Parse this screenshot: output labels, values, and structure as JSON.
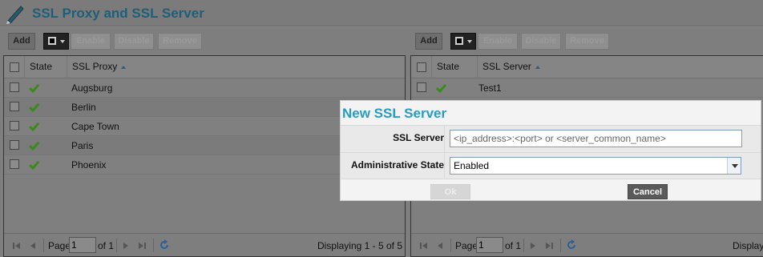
{
  "page": {
    "title": "SSL Proxy and SSL Server"
  },
  "toolbar": {
    "add": "Add",
    "enable": "Enable",
    "disable": "Disable",
    "remove": "Remove"
  },
  "left_grid": {
    "col_state": "State",
    "col_name": "SSL Proxy",
    "rows": [
      "Augsburg",
      "Berlin",
      "Cape Town",
      "Paris",
      "Phoenix"
    ]
  },
  "right_grid": {
    "col_state": "State",
    "col_name": "SSL Server",
    "rows": [
      "Test1"
    ]
  },
  "pager": {
    "page_label": "Page",
    "page_value": "1",
    "of_label": "of 1",
    "left_display": "Displaying 1 - 5 of 5",
    "right_display": "Displayi"
  },
  "dialog": {
    "title": "New SSL Server",
    "server_label": "SSL Server",
    "server_placeholder": "<ip_address>:<port> or <server_common_name>",
    "state_label": "Administrative State",
    "state_value": "Enabled",
    "ok": "Ok",
    "cancel": "Cancel"
  },
  "colors": {
    "title": "#1d5f7a",
    "dialog_title": "#2a9bc0",
    "check": "#3a8a1a"
  }
}
